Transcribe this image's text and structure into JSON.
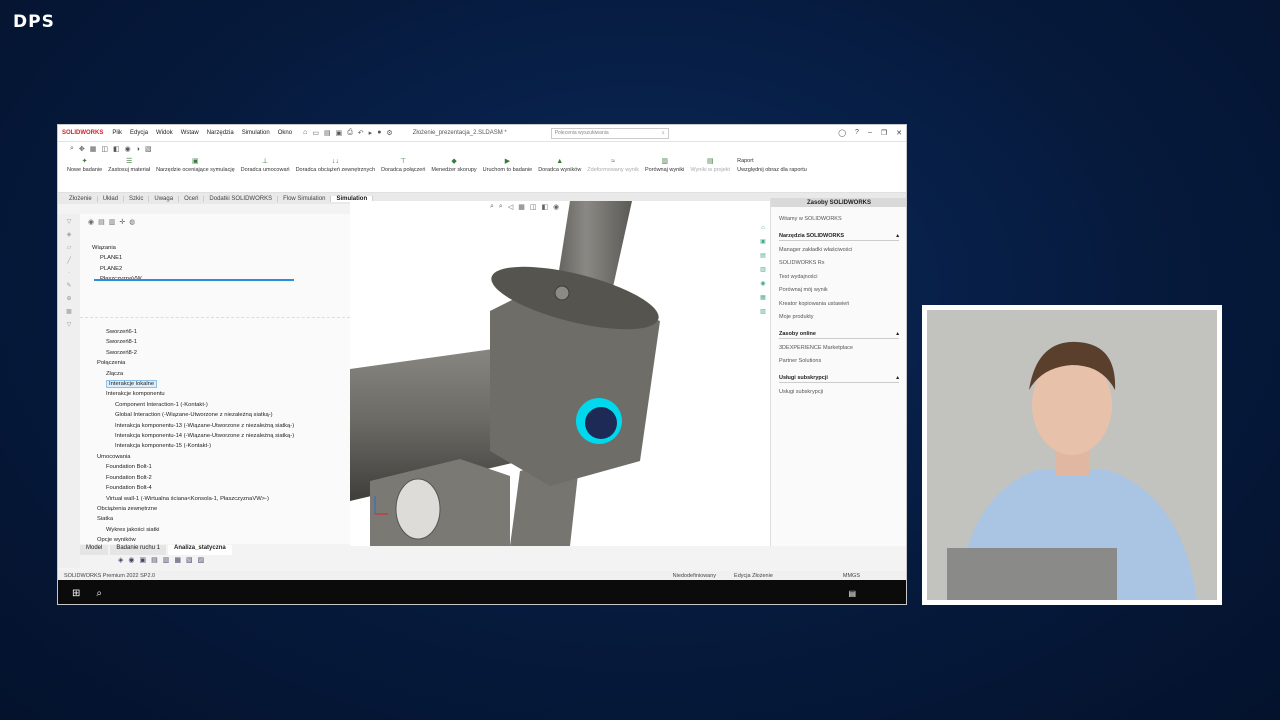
{
  "brand_logo": "DPS",
  "app": {
    "brand": "SOLIDWORKS",
    "menu": [
      "Plik",
      "Edycja",
      "Widok",
      "Wstaw",
      "Narzędzia",
      "Simulation",
      "Okno"
    ],
    "doc_title": "Złożenie_prezentacja_2.SLDASM *",
    "search_placeholder": "Polecenia wyszukiwania",
    "ribbon": [
      {
        "label": "Nowe badanie",
        "icon": "new-study-icon"
      },
      {
        "label": "Zastosuj materiał",
        "icon": "material-icon"
      },
      {
        "label": "Narzędzie oceniające symulację",
        "icon": "evaluator-icon"
      },
      {
        "label": "Doradca umocowań",
        "icon": "fixtures-advisor-icon"
      },
      {
        "label": "Doradca obciążeń zewnętrznych",
        "icon": "loads-advisor-icon"
      },
      {
        "label": "Doradca połączeń",
        "icon": "connections-advisor-icon"
      },
      {
        "label": "Menedżer skorupy",
        "icon": "shell-manager-icon"
      },
      {
        "label": "Uruchom to badanie",
        "icon": "run-icon"
      },
      {
        "label": "Doradca wyników",
        "icon": "results-advisor-icon"
      },
      {
        "label": "Zdeformowany wynik",
        "icon": "deformed-icon",
        "dim": true
      },
      {
        "label": "Porównaj wyniki",
        "icon": "compare-icon"
      },
      {
        "label": "Wyniki w projekt",
        "icon": "results-icon",
        "dim": true
      }
    ],
    "ribbon_side": {
      "report": "Raport",
      "include_image": "Uwzględnij obraz dla raportu"
    },
    "tabs": [
      "Złożenie",
      "Układ",
      "Szkic",
      "Uwaga",
      "Oceń",
      "Dodatki SOLIDWORKS",
      "Flow Simulation",
      "Simulation"
    ],
    "active_tab": "Simulation",
    "tree_top": [
      "Wiązania",
      "PLANE1",
      "PLANE2",
      "PłaszczyznaVW"
    ],
    "tree": [
      {
        "text": "Sworzeń6-1",
        "indent": 2
      },
      {
        "text": "Sworzeń8-1",
        "indent": 2
      },
      {
        "text": "Sworzeń8-2",
        "indent": 2
      },
      {
        "text": "Połączenia",
        "indent": 1
      },
      {
        "text": "Złącza",
        "indent": 2
      },
      {
        "text": "Interakcje lokalne",
        "indent": 2,
        "selected": true
      },
      {
        "text": "Interakcje komponentu",
        "indent": 2
      },
      {
        "text": "Component Interaction-1 (-Kontakt-)",
        "indent": 3
      },
      {
        "text": "Global Interaction (-Wiązane-Utworzone z niezależną siatką-)",
        "indent": 3
      },
      {
        "text": "Interakcja komponentu-13 (-Wiązane-Utworzone z niezależną siatką-)",
        "indent": 3
      },
      {
        "text": "Interakcja komponentu-14 (-Wiązane-Utworzone z niezależną siatką-)",
        "indent": 3
      },
      {
        "text": "Interakcja komponentu-15 (-Kontakt-)",
        "indent": 3
      },
      {
        "text": "Umocowania",
        "indent": 1
      },
      {
        "text": "Foundation Bolt-1",
        "indent": 2
      },
      {
        "text": "Foundation Bolt-2",
        "indent": 2
      },
      {
        "text": "Foundation Bolt-4",
        "indent": 2
      },
      {
        "text": "Virtual wall-1 (-Wirtualna ściana<Konsola-1, PłaszczyznaVW>-)",
        "indent": 2
      },
      {
        "text": "Obciążenia zewnętrzne",
        "indent": 1
      },
      {
        "text": "Siatka",
        "indent": 1
      },
      {
        "text": "Wykres jakości siatki",
        "indent": 2
      },
      {
        "text": "Opcje wyników",
        "indent": 1
      }
    ],
    "task_pane": {
      "title": "Zasoby SOLIDWORKS",
      "welcome": "Witamy w SOLIDWORKS",
      "sections": [
        {
          "title": "Narzędzia SOLIDWORKS",
          "items": [
            "Manager zakładki właściwości",
            "SOLIDWORKS Rx",
            "Test wydajności",
            "Porównaj mój wynik",
            "Kreator kopiowania ustawień",
            "Moje produkty"
          ]
        },
        {
          "title": "Zasoby online",
          "items": [
            "3DEXPERIENCE Marketplace",
            "Partner Solutions"
          ]
        },
        {
          "title": "Usługi subskrypcji",
          "items": [
            "Usługi subskrypcji"
          ]
        }
      ]
    },
    "bottom_tabs": [
      "Model",
      "Badanie ruchu 1",
      "Analiza_statyczna"
    ],
    "active_bottom_tab": "Analiza_statyczna",
    "status": {
      "version": "SOLIDWORKS Premium 2022 SP2.0",
      "state": "Niedodefiniowany",
      "mode": "Edycja Złożenie",
      "units": "MMGS"
    }
  },
  "colors": {
    "accent": "#d32027",
    "highlight": "#00e5ff",
    "model": "#6e6d68"
  }
}
